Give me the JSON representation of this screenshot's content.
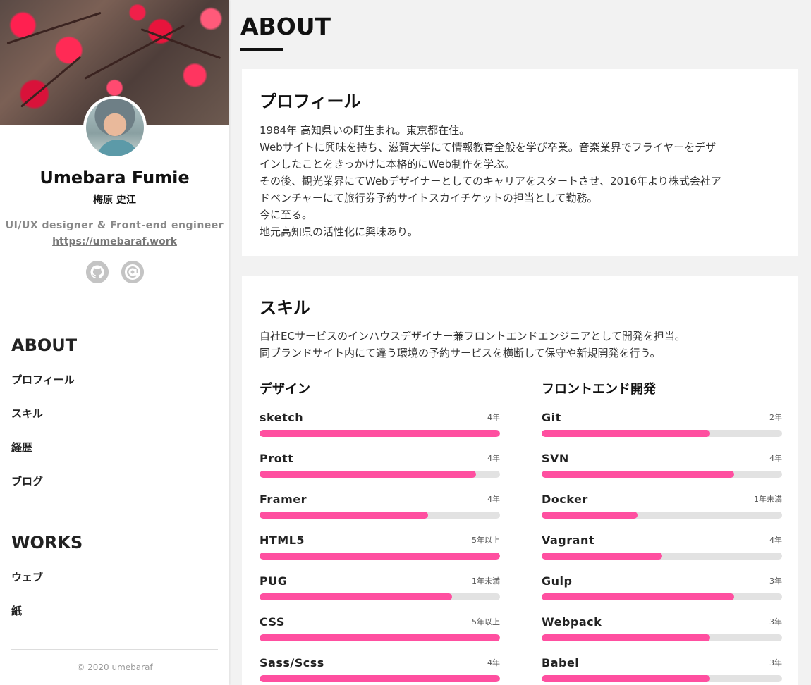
{
  "profile": {
    "name": "Umebara Fumie",
    "kanji_name": "梅原 史江",
    "role": "UI/UX designer & Front-end engineer",
    "url": "https://umebaraf.work"
  },
  "social": [
    {
      "icon": "github-icon"
    },
    {
      "icon": "at-sign-icon"
    }
  ],
  "nav": {
    "about": {
      "heading": "ABOUT",
      "items": [
        "プロフィール",
        "スキル",
        "経歴",
        "ブログ"
      ]
    },
    "works": {
      "heading": "WORKS",
      "items": [
        "ウェブ",
        "紙"
      ]
    }
  },
  "copyright": "© 2020 umebaraf",
  "page_title": "ABOUT",
  "profile_section": {
    "heading": "プロフィール",
    "lines": [
      "1984年 高知県いの町生まれ。東京都在住。",
      "Webサイトに興味を持ち、滋賀大学にて情報教育全般を学び卒業。音楽業界でフライヤーをデザ",
      "インしたことをきっかけに本格的にWeb制作を学ぶ。",
      "その後、観光業界にてWebデザイナーとしてのキャリアをスタートさせ、2016年より株式会社ア",
      "ドベンチャーにて旅行券予約サイトスカイチケットの担当として勤務。",
      "今に至る。",
      "地元高知県の活性化に興味あり。"
    ]
  },
  "skills_section": {
    "heading": "スキル",
    "lines": [
      "自社ECサービスのインハウスデザイナー兼フロントエンドエンジニアとして開発を担当。",
      "同ブランドサイト内にて違う環境の予約サービスを横断して保守や新規開発を行う。"
    ],
    "bar_color": "#ff4fa0",
    "track_color": "#e2e2e2",
    "columns": [
      {
        "heading": "デザイン",
        "skills": [
          {
            "name": "sketch",
            "years": "4年",
            "level": 1.0
          },
          {
            "name": "Prott",
            "years": "4年",
            "level": 0.9
          },
          {
            "name": "Framer",
            "years": "4年",
            "level": 0.7
          },
          {
            "name": "HTML5",
            "years": "5年以上",
            "level": 1.0
          },
          {
            "name": "PUG",
            "years": "1年未満",
            "level": 0.8
          },
          {
            "name": "CSS",
            "years": "5年以上",
            "level": 1.0
          },
          {
            "name": "Sass/Scss",
            "years": "4年",
            "level": 1.0
          }
        ]
      },
      {
        "heading": "フロントエンド開発",
        "skills": [
          {
            "name": "Git",
            "years": "2年",
            "level": 0.7
          },
          {
            "name": "SVN",
            "years": "4年",
            "level": 0.8
          },
          {
            "name": "Docker",
            "years": "1年未満",
            "level": 0.4
          },
          {
            "name": "Vagrant",
            "years": "4年",
            "level": 0.5
          },
          {
            "name": "Gulp",
            "years": "3年",
            "level": 0.8
          },
          {
            "name": "Webpack",
            "years": "3年",
            "level": 0.7
          },
          {
            "name": "Babel",
            "years": "3年",
            "level": 0.7
          }
        ]
      }
    ]
  }
}
